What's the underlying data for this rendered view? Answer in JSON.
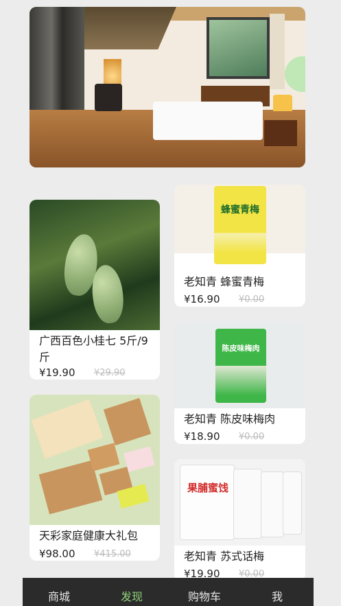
{
  "banner": {
    "alt": ""
  },
  "products": [
    {
      "name": "广西百色小桂七 5斤/9斤",
      "price": "¥19.90",
      "old_price": "¥29.90"
    },
    {
      "name": "天彩家庭健康大礼包",
      "price": "¥98.00",
      "old_price": "¥415.00"
    },
    {
      "name": "老知青 蜂蜜青梅",
      "price": "¥16.90",
      "old_price": "¥0.00",
      "pkg_text": "蜂蜜青梅"
    },
    {
      "name": "老知青 陈皮味梅肉",
      "price": "¥18.90",
      "old_price": "¥0.00",
      "pkg_text": "陈皮味梅肉"
    },
    {
      "name": "老知青 苏式话梅",
      "price": "¥19.90",
      "old_price": "¥0.00",
      "pkg_text": "果脯蜜饯"
    }
  ],
  "tabbar": {
    "items": [
      "商城",
      "发现",
      "购物车",
      "我"
    ],
    "active": "发现",
    "active_color": "#8fd37a",
    "bg_color": "#2b2b2b"
  }
}
